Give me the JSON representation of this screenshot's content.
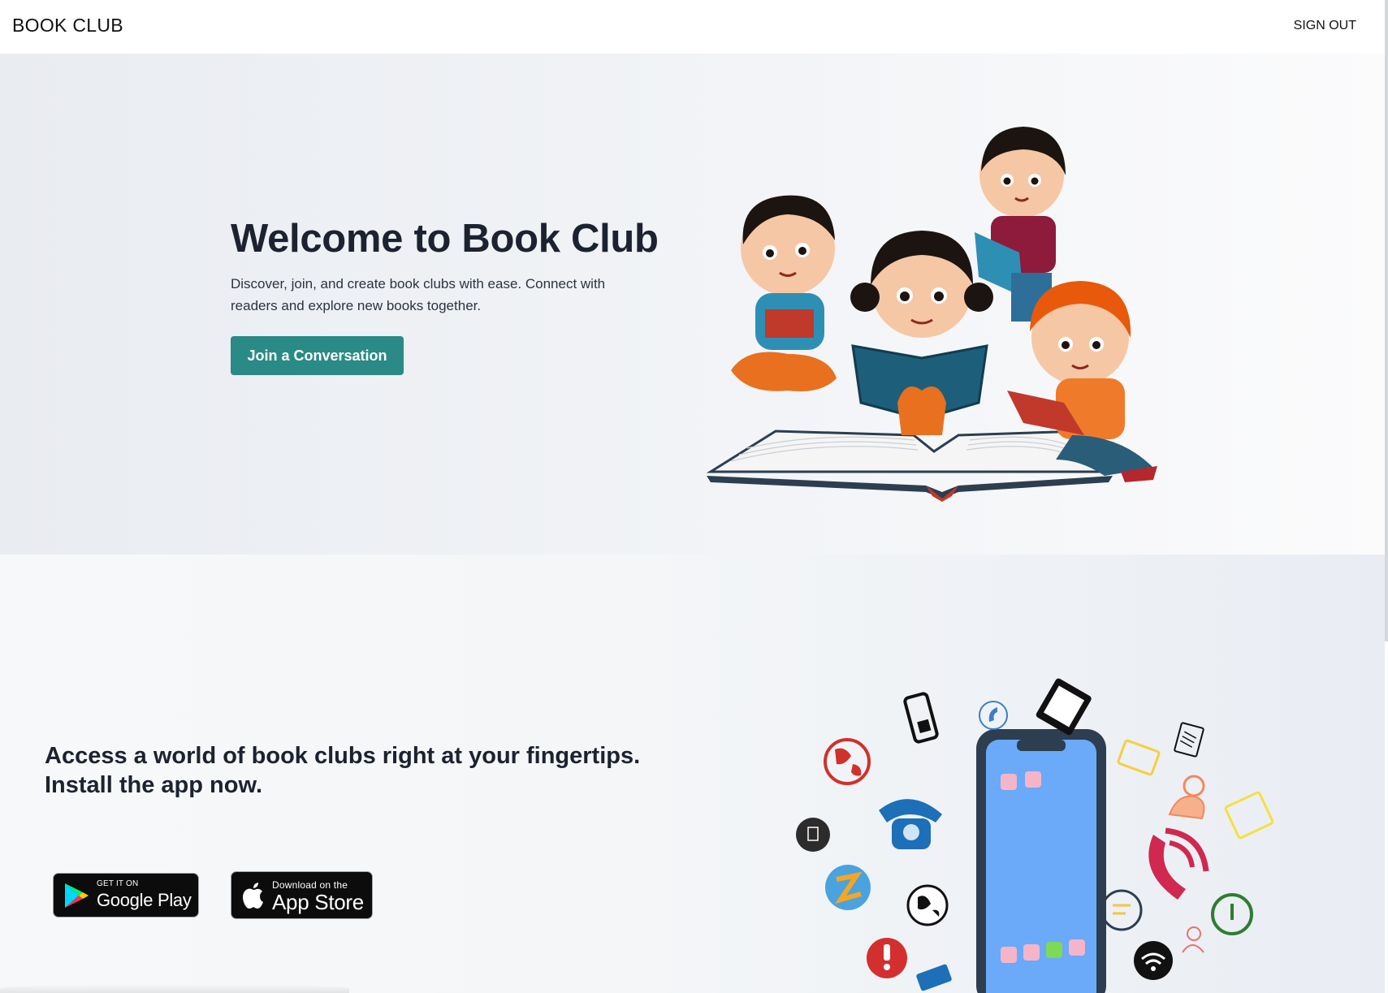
{
  "navbar": {
    "brand": "BOOK CLUB",
    "signout_label": "SIGN OUT"
  },
  "hero": {
    "title": "Welcome to Book Club",
    "description": "Discover, join, and create book clubs with ease. Connect with readers and explore new books together.",
    "cta_label": "Join a Conversation",
    "illustration": "children-reading-books-illustration"
  },
  "app_promo": {
    "title_line1": "Access a world of book clubs right at your fingertips.",
    "title_line2": "Install the app now.",
    "google_play": {
      "small": "GET IT ON",
      "big": "Google Play"
    },
    "app_store": {
      "small": "Download on the",
      "big": "App Store"
    },
    "illustration": "smartphone-with-app-icons-illustration"
  },
  "colors": {
    "accent": "#2a8a86",
    "text": "#1c2230",
    "hero_bg": "#eef0f4"
  }
}
